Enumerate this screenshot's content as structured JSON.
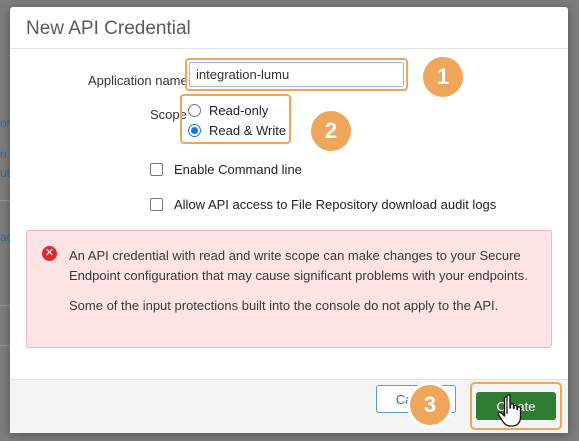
{
  "background": {
    "fragments": [
      "on",
      "n",
      "ut",
      "ac"
    ]
  },
  "dialog": {
    "title": "New API Credential",
    "application_name": {
      "label": "Application name",
      "value": "integration-lumu"
    },
    "scope": {
      "label": "Scope",
      "options": [
        {
          "label": "Read-only",
          "selected": false
        },
        {
          "label": "Read & Write",
          "selected": true
        }
      ]
    },
    "checkboxes": [
      {
        "label": "Enable Command line",
        "checked": false
      },
      {
        "label": "Allow API access to File Repository download audit logs",
        "checked": false
      }
    ],
    "alert": {
      "icon": "x-circle-icon",
      "paragraphs": [
        "An API credential with read and write scope can make changes to your Secure Endpoint configuration that may cause significant problems with your endpoints.",
        "Some of the input protections built into the console do not apply to the API."
      ]
    },
    "footer": {
      "cancel_label": "Cancel",
      "create_label": "Create"
    }
  },
  "callouts": [
    "1",
    "2",
    "3"
  ],
  "colors": {
    "accent_orange": "#f0a65a",
    "create_green": "#2f7d32",
    "alert_bg": "#fde3e4",
    "alert_icon_red": "#d92b35"
  }
}
